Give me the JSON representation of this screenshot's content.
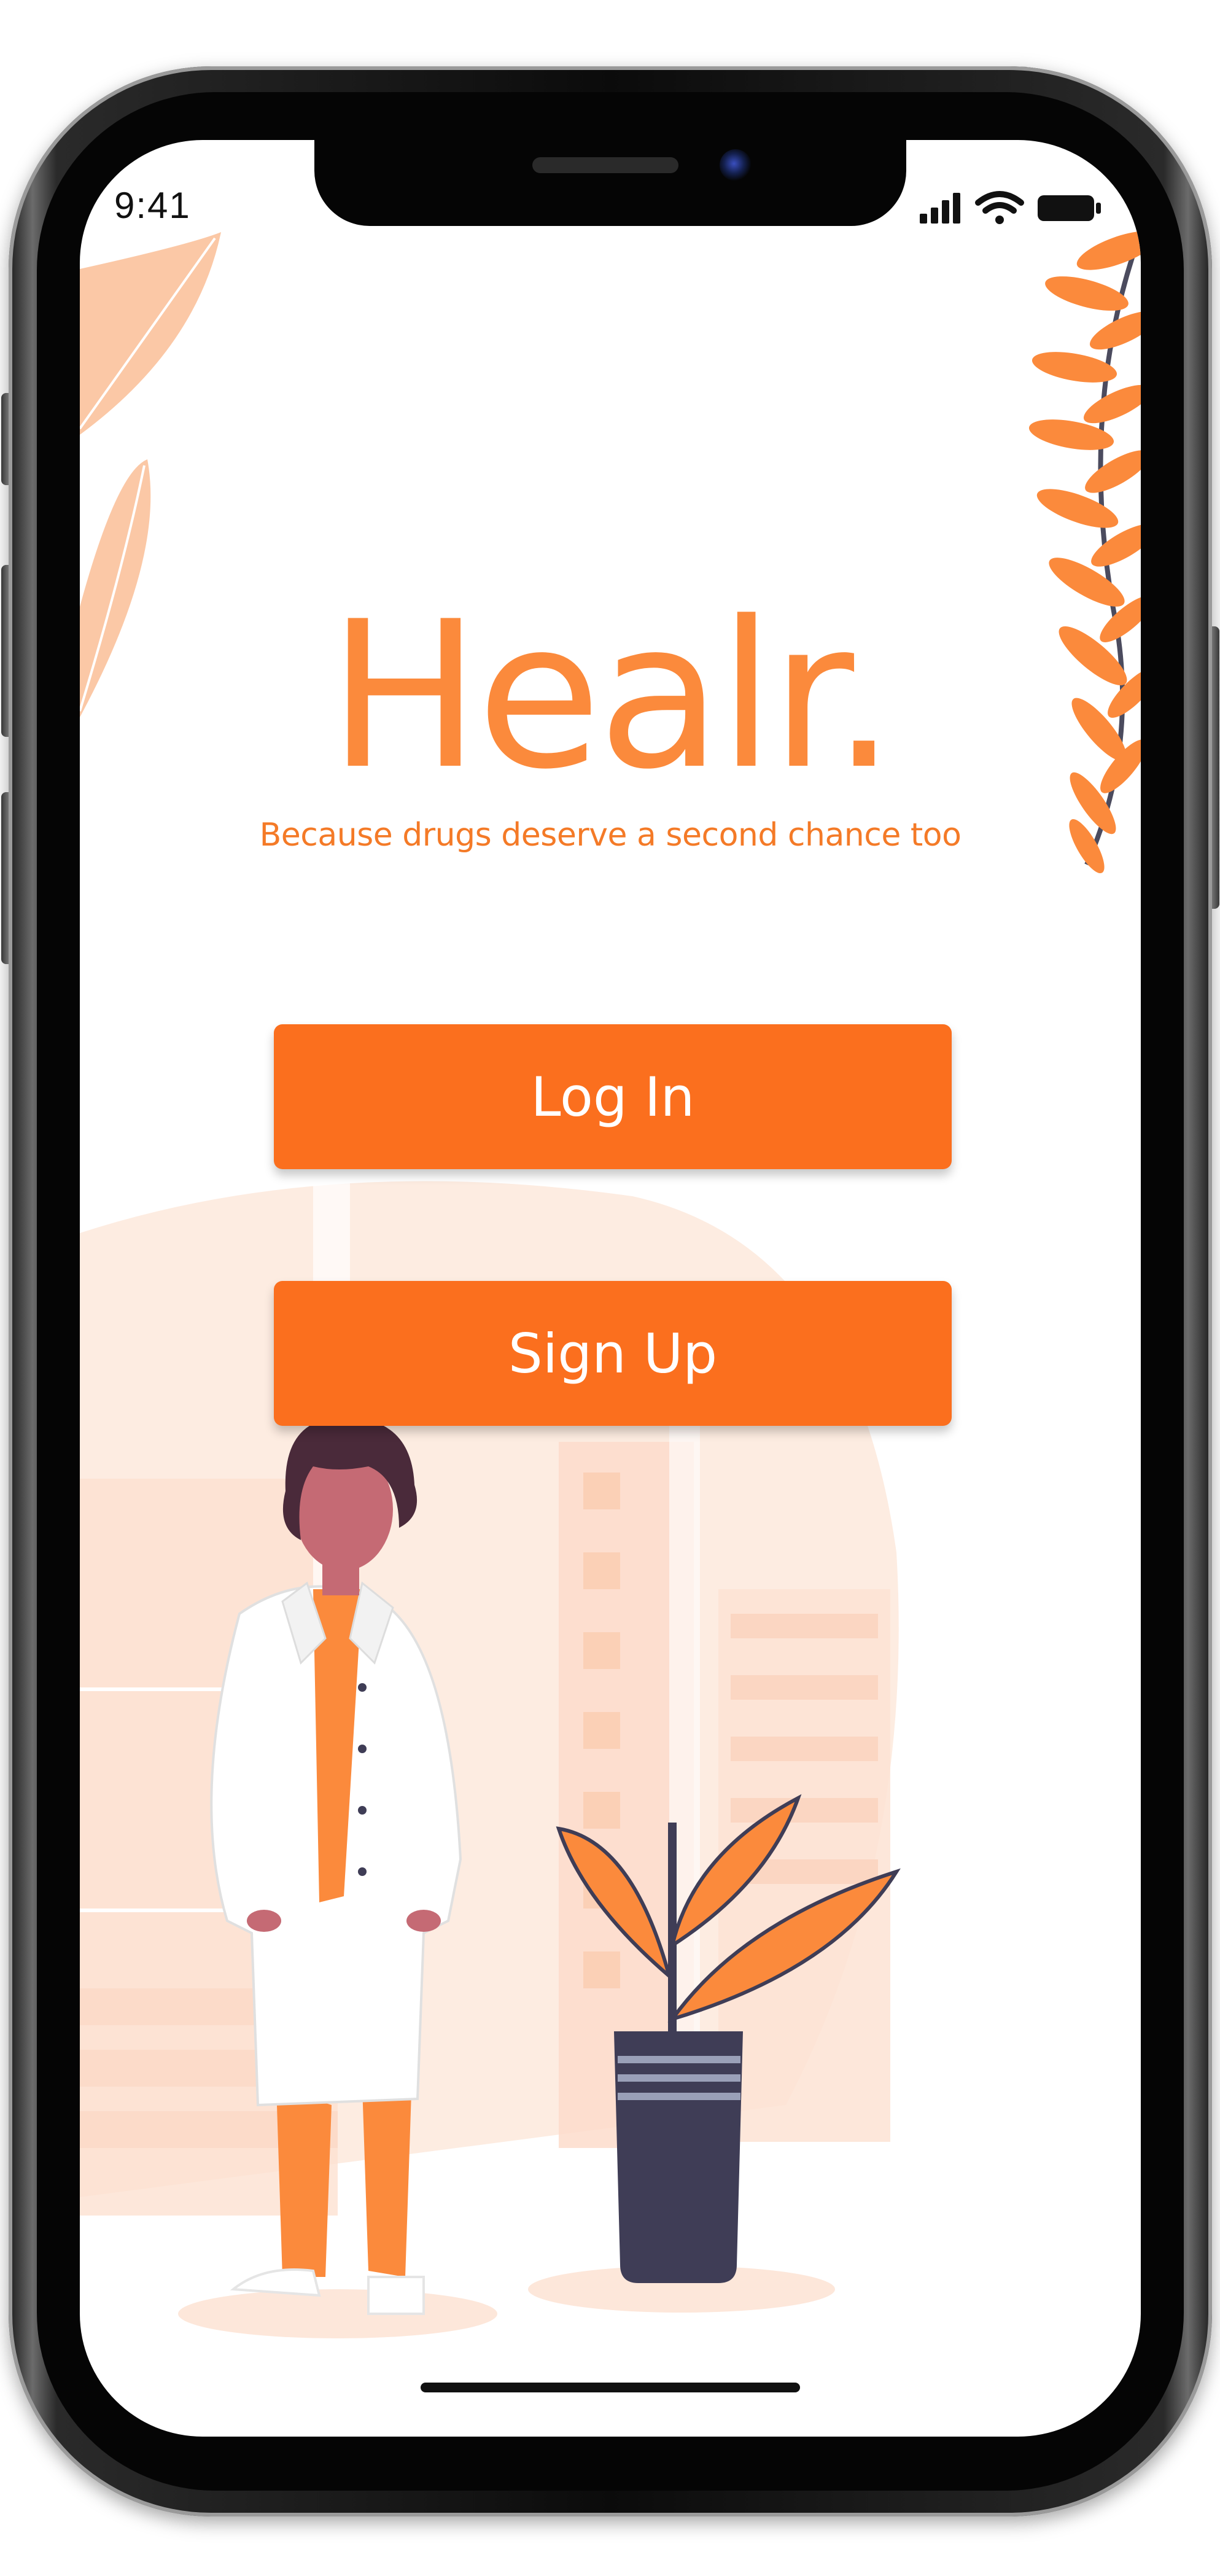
{
  "status_bar": {
    "time": "9:41",
    "icons": [
      "signal-icon",
      "wifi-icon",
      "battery-icon"
    ]
  },
  "app": {
    "title": "Healr.",
    "tagline": "Because drugs deserve a second chance too"
  },
  "actions": {
    "login_label": "Log In",
    "signup_label": "Sign Up"
  },
  "colors": {
    "brand_orange": "#fb6f1e",
    "title_orange": "#fb8a3c",
    "peach_background": "#fde7da",
    "navy": "#3f3d56",
    "skin": "#c56a74",
    "hair": "#4a2a3a"
  }
}
